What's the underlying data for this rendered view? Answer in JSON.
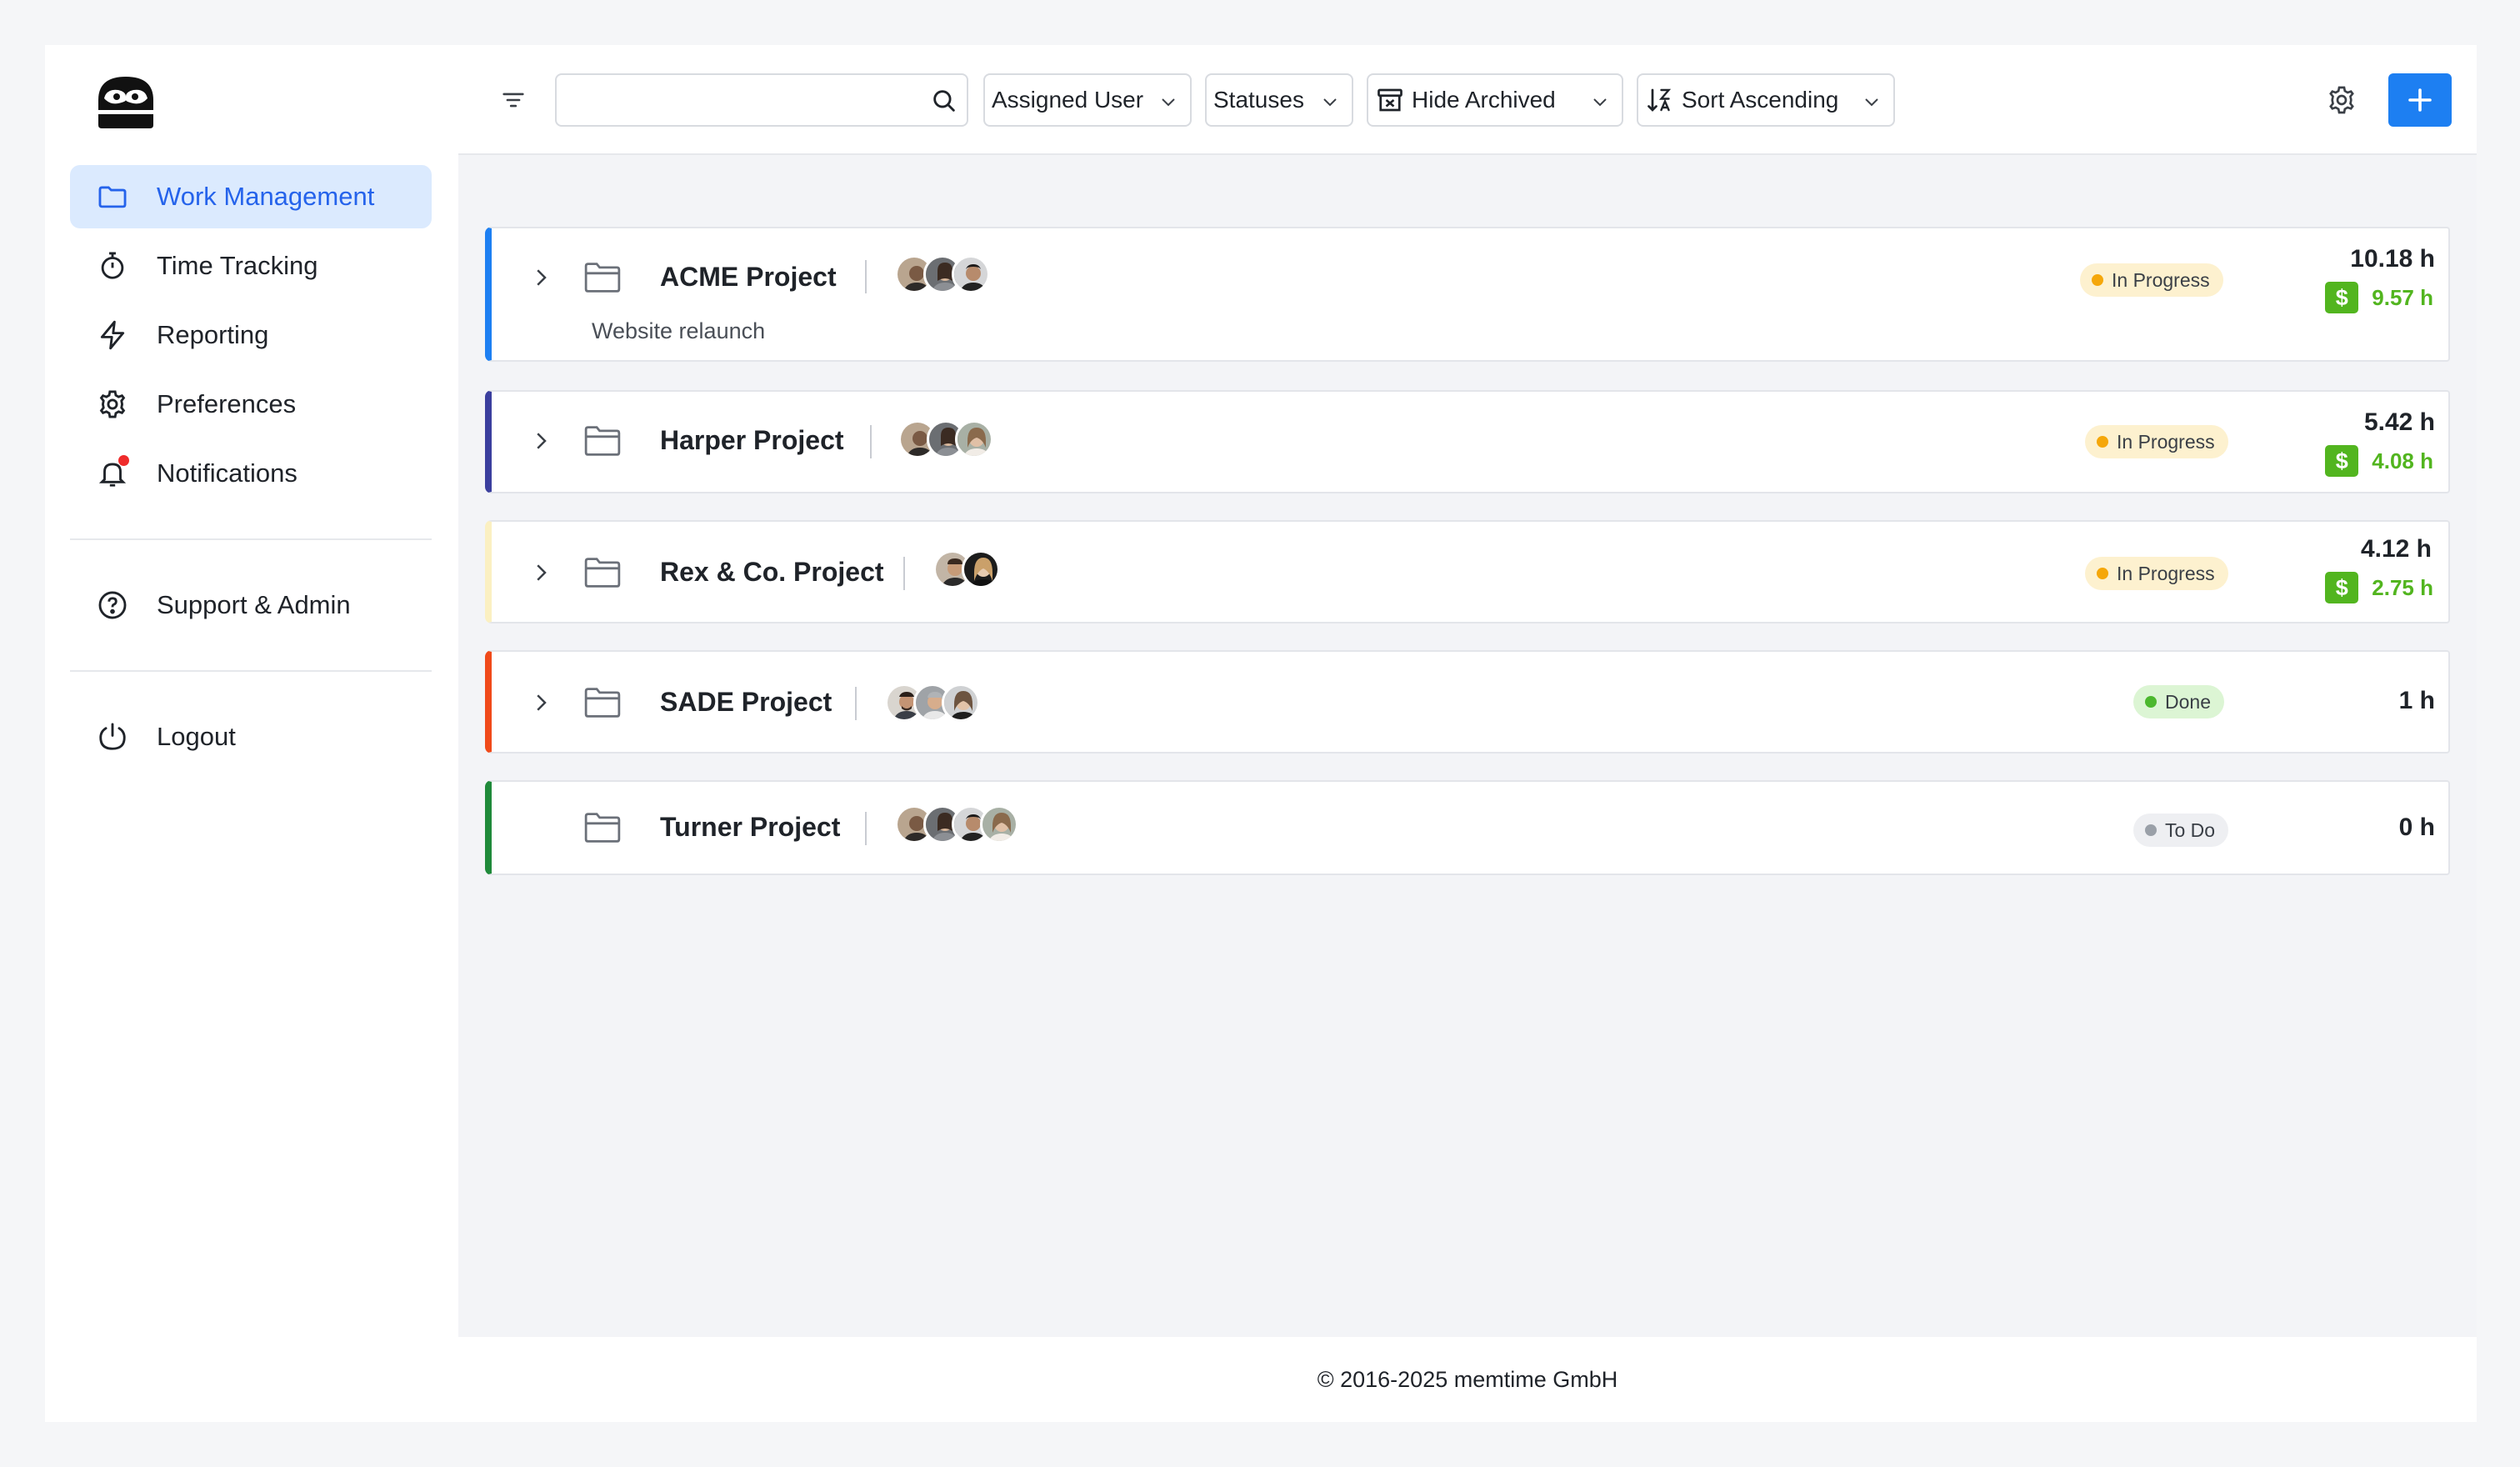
{
  "sidebar": {
    "items": [
      {
        "label": "Work Management",
        "icon": "folder-icon",
        "active": true
      },
      {
        "label": "Time Tracking",
        "icon": "stopwatch-icon"
      },
      {
        "label": "Reporting",
        "icon": "lightning-icon"
      },
      {
        "label": "Preferences",
        "icon": "gear-icon"
      },
      {
        "label": "Notifications",
        "icon": "bell-icon"
      }
    ],
    "support": {
      "label": "Support & Admin",
      "icon": "help-circle-icon"
    },
    "logout": {
      "label": "Logout",
      "icon": "power-icon"
    }
  },
  "toolbar": {
    "search_value": "",
    "assigned_user": "Assigned User",
    "statuses": "Statuses",
    "archived": "Hide Archived",
    "sort": "Sort Ascending"
  },
  "projects": [
    {
      "name": "ACME Project",
      "subtitle": "Website relaunch",
      "status": "In Progress",
      "hours": "10.18 h",
      "billable": "9.57 h",
      "color": "#1d7ff2",
      "avatars": 3
    },
    {
      "name": "Harper Project",
      "status": "In Progress",
      "hours": "5.42 h",
      "billable": "4.08 h",
      "color": "#3b3f9e",
      "avatars": 3
    },
    {
      "name": "Rex & Co. Project",
      "status": "In Progress",
      "hours": "4.12 h",
      "billable": "2.75 h",
      "color": "#fbf0c2",
      "avatars": 2
    },
    {
      "name": "SADE Project",
      "status": "Done",
      "hours": "1 h",
      "color": "#f04a1a",
      "avatars": 3
    },
    {
      "name": "Turner Project",
      "status": "To Do",
      "hours": "0 h",
      "color": "#1f8a3a",
      "avatars": 4
    }
  ],
  "colors": {
    "accent": "#1d7ff2",
    "billable": "#52b51f"
  },
  "footer": "© 2016-2025 memtime GmbH"
}
